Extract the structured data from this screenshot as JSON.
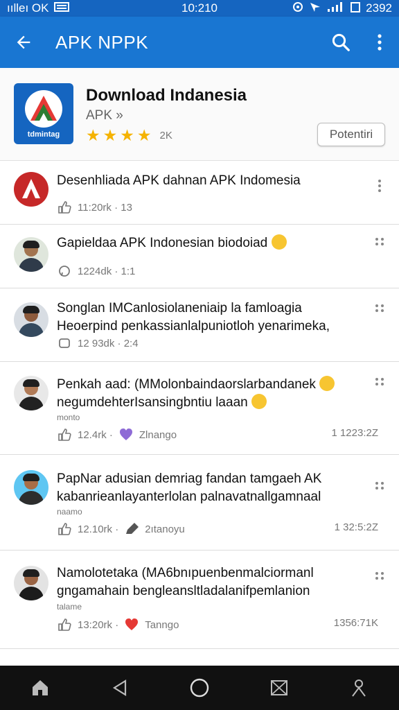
{
  "status_bar": {
    "carrier": "ıılleı OK",
    "time": "10:210",
    "battery": "2392"
  },
  "app_bar": {
    "title": "APK NPPK"
  },
  "app": {
    "name": "Download Indanesia",
    "subtitle": "APK »",
    "icon_caption": "tdmintag",
    "rating_stars": 4,
    "rating_count": "2K",
    "download_label": "Potentiri"
  },
  "feed": {
    "items": [
      {
        "lines": [
          "Desenhliada APK dahnan APK Indomesia"
        ],
        "small": "",
        "meta": "11:20rk · 13",
        "time": ""
      },
      {
        "lines": [
          "Gapieldaa APK Indonesian biodoiad"
        ],
        "small": "",
        "meta": "1224dk · 1:1",
        "time": ""
      },
      {
        "lines": [
          "Songlan IMCanlosiolaneniaip la famloagia",
          "Heoerpind penkassianlalpuniotloh yenarimeka,"
        ],
        "small": "",
        "meta": "12 93dk · 2:4",
        "time": ""
      },
      {
        "lines": [
          "Penkah aad: (MMolonbaindaorslarbandanek",
          "negumdehterIsansingbntiu laaan"
        ],
        "small": "monto",
        "meta": "12.4rk · ",
        "meta_label": "Zlnango",
        "time": "1 1223:2Z"
      },
      {
        "lines": [
          "PapNar adusian demriag fandan tamgaeh AK",
          "kabanrieanlayanterlolan palnavatnallgamnaal"
        ],
        "small": "naamo",
        "meta": "12.10rk · ",
        "meta_label": "2ıtanoyu",
        "time": "1 32:5:2Z"
      },
      {
        "lines": [
          "Namolotetaka (MA6bnıpuenbenmalciormanl",
          "gngamahain bengleansltladalanifpemlanion"
        ],
        "small": "talame",
        "meta": "13:20rk · ",
        "meta_label": "Tanngo",
        "time": "1356:71K"
      }
    ]
  },
  "colors": {
    "app_bar": "#1976d2",
    "status_bar": "#1565c0",
    "star": "#f5b301"
  }
}
